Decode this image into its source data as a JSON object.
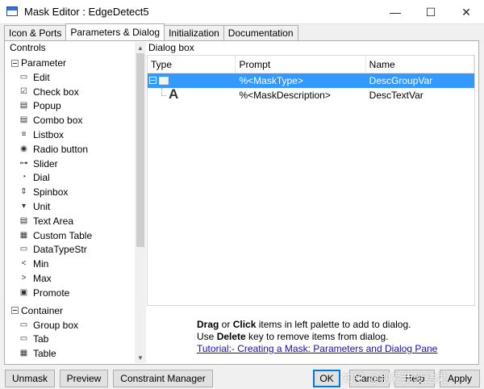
{
  "window": {
    "title": "Mask Editor : EdgeDetect5",
    "minimize_glyph": "—",
    "maximize_glyph": "☐",
    "close_glyph": "✕"
  },
  "tabs": [
    {
      "label": "Icon & Ports",
      "active": false
    },
    {
      "label": "Parameters & Dialog",
      "active": true
    },
    {
      "label": "Initialization",
      "active": false
    },
    {
      "label": "Documentation",
      "active": false
    }
  ],
  "controls": {
    "header": "Controls",
    "parameter_group": "Parameter",
    "parameter_items": [
      {
        "label": "Edit",
        "icon": "edit-icon",
        "glyph": "▭"
      },
      {
        "label": "Check box",
        "icon": "checkbox-icon",
        "glyph": "☑"
      },
      {
        "label": "Popup",
        "icon": "popup-icon",
        "glyph": "▤"
      },
      {
        "label": "Combo box",
        "icon": "combobox-icon",
        "glyph": "▤"
      },
      {
        "label": "Listbox",
        "icon": "listbox-icon",
        "glyph": "≡"
      },
      {
        "label": "Radio button",
        "icon": "radio-button-icon",
        "glyph": "◉"
      },
      {
        "label": "Slider",
        "icon": "slider-icon",
        "glyph": "⊶"
      },
      {
        "label": "Dial",
        "icon": "dial-icon",
        "glyph": "◔"
      },
      {
        "label": "Spinbox",
        "icon": "spinbox-icon",
        "glyph": "⇕"
      },
      {
        "label": "Unit",
        "icon": "unit-icon",
        "glyph": "▾"
      },
      {
        "label": "Text Area",
        "icon": "text-area-icon",
        "glyph": "▤"
      },
      {
        "label": "Custom Table",
        "icon": "custom-table-icon",
        "glyph": "▦"
      },
      {
        "label": "DataTypeStr",
        "icon": "datatypestr-icon",
        "glyph": "▭"
      },
      {
        "label": "Min",
        "icon": "min-icon",
        "glyph": "<"
      },
      {
        "label": "Max",
        "icon": "max-icon",
        "glyph": ">"
      },
      {
        "label": "Promote",
        "icon": "promote-icon",
        "glyph": "▣"
      }
    ],
    "container_group": "Container",
    "container_items": [
      {
        "label": "Group box",
        "icon": "group-box-icon",
        "glyph": "▭"
      },
      {
        "label": "Tab",
        "icon": "tab-icon",
        "glyph": "▭"
      },
      {
        "label": "Table",
        "icon": "table-icon",
        "glyph": "▦"
      }
    ]
  },
  "dialog": {
    "header": "Dialog box",
    "columns": [
      "Type",
      "Prompt",
      "Name"
    ],
    "rows": [
      {
        "prompt": "%<MaskType>",
        "name": "DescGroupVar",
        "selected": true
      },
      {
        "prompt": "%<MaskDescription>",
        "name": "DescTextVar",
        "selected": false,
        "type_glyph": "A"
      }
    ]
  },
  "help": {
    "line1_bold_a": "Drag",
    "line1_mid": " or ",
    "line1_bold_b": "Click",
    "line1_rest": " items in left palette to add to dialog.",
    "line2_pre": "Use ",
    "line2_bold": "Delete",
    "line2_rest": " key to remove items from dialog.",
    "link": "Tutorial:- Creating a Mask: Parameters and Dialog Pane"
  },
  "buttons": {
    "unmask": "Unmask",
    "preview": "Preview",
    "constraint_manager": "Constraint Manager",
    "ok": "OK",
    "cancel": "Cancel",
    "help": "Help",
    "apply": "Apply"
  },
  "watermark": "知乎 @别爱我没结果",
  "colors": {
    "selection": "#3399ff",
    "link": "#1a0dab",
    "default_button_border": "#0078d7"
  }
}
